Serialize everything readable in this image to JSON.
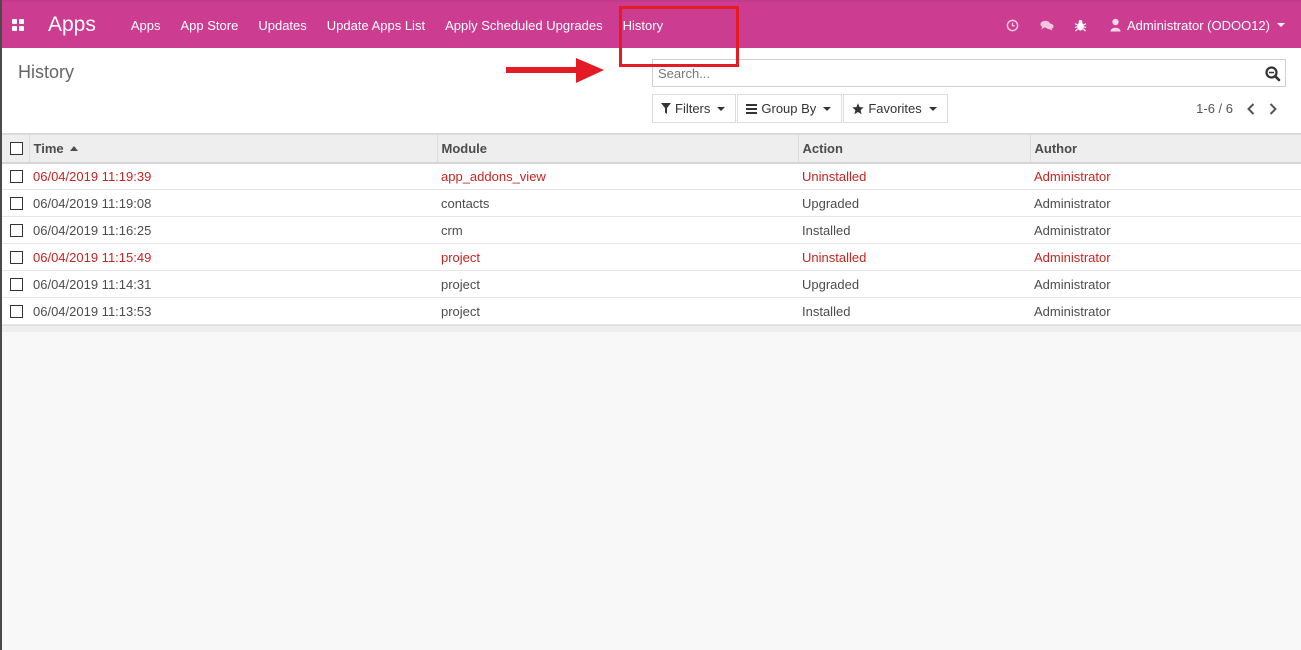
{
  "navbar": {
    "brand": "Apps",
    "menu": [
      "Apps",
      "App Store",
      "Updates",
      "Update Apps List",
      "Apply Scheduled Upgrades",
      "History"
    ],
    "user_label": "Administrator (ODOO12)",
    "icons": [
      "apps-grid-icon",
      "clock-icon",
      "chat-icon",
      "bug-icon",
      "user-icon"
    ]
  },
  "control_panel": {
    "breadcrumb": "History",
    "search_placeholder": "Search...",
    "filters_label": "Filters",
    "groupby_label": "Group By",
    "favorites_label": "Favorites",
    "pager": "1-6 / 6"
  },
  "table": {
    "columns": [
      "Time",
      "Module",
      "Action",
      "Author"
    ],
    "rows": [
      {
        "time": "06/04/2019 11:19:39",
        "module": "app_addons_view",
        "action": "Uninstalled",
        "author": "Administrator"
      },
      {
        "time": "06/04/2019 11:19:08",
        "module": "contacts",
        "action": "Upgraded",
        "author": "Administrator"
      },
      {
        "time": "06/04/2019 11:16:25",
        "module": "crm",
        "action": "Installed",
        "author": "Administrator"
      },
      {
        "time": "06/04/2019 11:15:49",
        "module": "project",
        "action": "Uninstalled",
        "author": "Administrator"
      },
      {
        "time": "06/04/2019 11:14:31",
        "module": "project",
        "action": "Upgraded",
        "author": "Administrator"
      },
      {
        "time": "06/04/2019 11:13:53",
        "module": "project",
        "action": "Installed",
        "author": "Administrator"
      }
    ]
  },
  "colors": {
    "navbar": "#cc3d92",
    "uninstalled_row": "#c7241f",
    "annotation": "#e41b25"
  }
}
